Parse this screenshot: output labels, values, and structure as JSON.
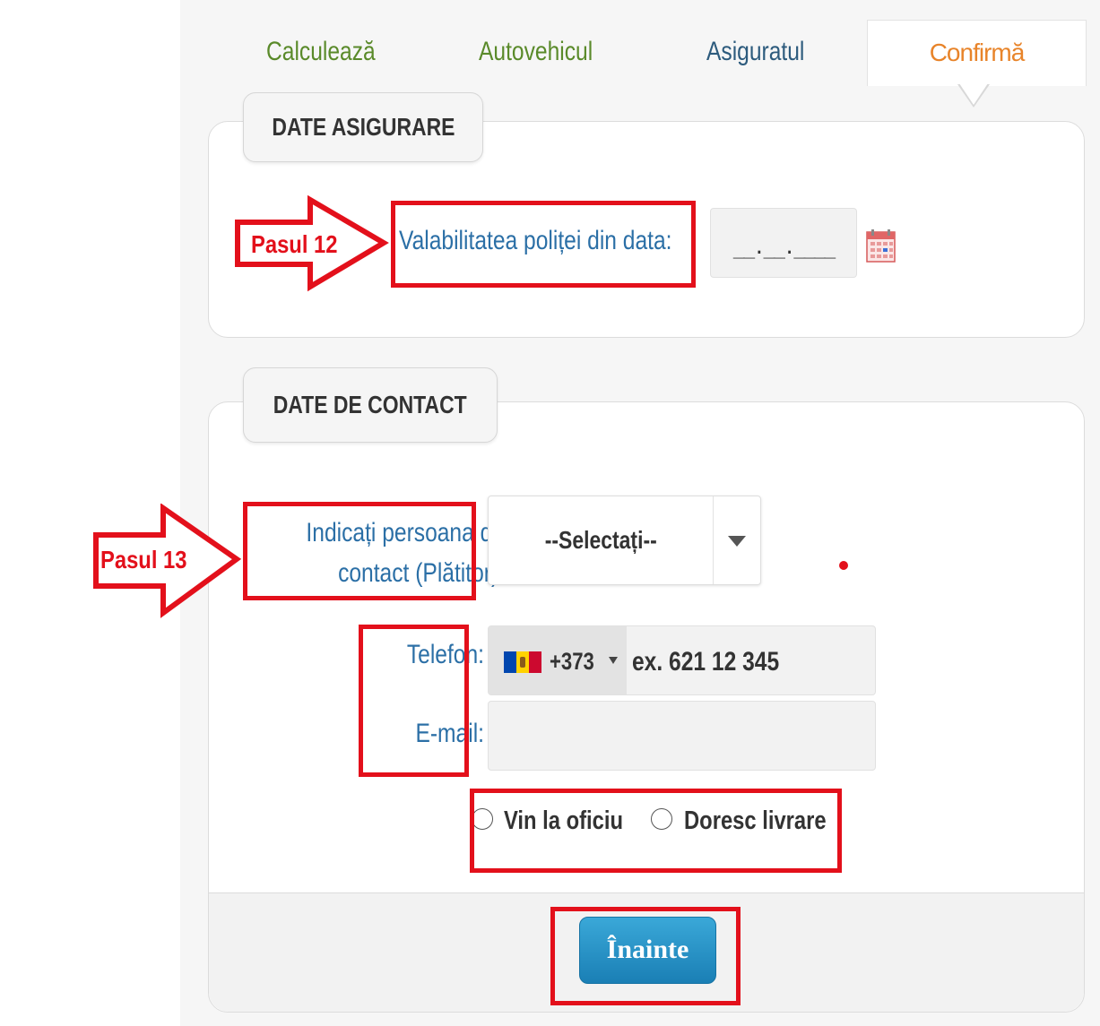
{
  "tabs": {
    "calc": "Calculează",
    "auto": "Autovehicul",
    "asig": "Asiguratul",
    "confirm": "Confirmă"
  },
  "asigurare": {
    "legend": "DATE ASIGURARE",
    "valab_label": "Valabilitatea poliței din data:",
    "date_placeholder": "__.__.____"
  },
  "contact": {
    "legend": "DATE DE CONTACT",
    "person_label": "Indicați persoana de contact (Plătitor):",
    "select_value": "--Selectați--",
    "phone_label": "Telefon:",
    "phone_code": "+373",
    "phone_placeholder": "ex. 621 12 345",
    "email_label": "E-mail:",
    "radio_office": "Vin la oficiu",
    "radio_delivery": "Doresc livrare"
  },
  "footer": {
    "next_label": "Înainte"
  },
  "annotations": {
    "step12": "Pasul 12",
    "step13": "Pasul 13"
  },
  "colors": {
    "accent_red": "#e3101b",
    "tab_done": "#5a8a2a",
    "tab_active": "#e8842a",
    "label_blue": "#2b6fa6",
    "button_blue": "#1a7fb5"
  },
  "icons": [
    "calendar-icon",
    "chevron-down-icon",
    "moldova-flag-icon"
  ]
}
